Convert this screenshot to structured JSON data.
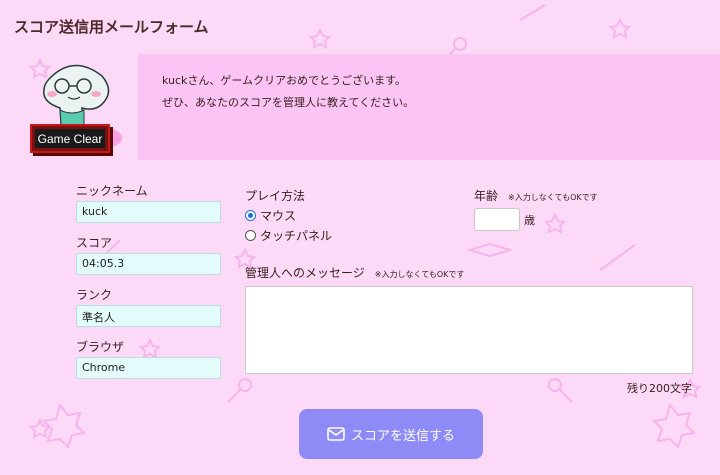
{
  "page": {
    "title": "スコア送信用メールフォーム"
  },
  "banner": {
    "line1": "kuckさん、ゲームクリアおめでとうございます。",
    "line2": "ぜひ、あなたのスコアを管理人に教えてください。",
    "badge": "Game Clear"
  },
  "form": {
    "nickname": {
      "label": "ニックネーム",
      "value": "kuck"
    },
    "score": {
      "label": "スコア",
      "value": "04:05.3"
    },
    "rank": {
      "label": "ランク",
      "value": "準名人"
    },
    "browser": {
      "label": "ブラウザ",
      "value": "Chrome"
    },
    "play": {
      "label": "プレイ方法",
      "options": [
        "マウス",
        "タッチパネル"
      ],
      "selected": "マウス"
    },
    "age": {
      "label": "年齢",
      "note": "※入力しなくてもOKです",
      "unit": "歳",
      "value": ""
    },
    "message": {
      "label": "管理人へのメッセージ",
      "note": "※入力しなくてもOKです",
      "value": ""
    },
    "remaining": "残り200文字",
    "submit": "スコアを送信する"
  },
  "colors": {
    "background": "#fcd9f6",
    "banner": "#fbc4f5",
    "field": "#e4fbfb",
    "submit": "#8f8bf6"
  }
}
